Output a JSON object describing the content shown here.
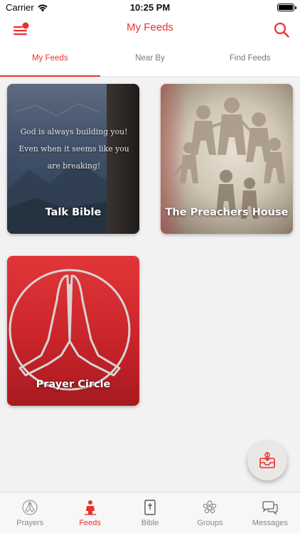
{
  "status_bar": {
    "carrier": "Carrier",
    "time": "10:25 PM"
  },
  "header": {
    "title": "My Feeds"
  },
  "top_tabs": [
    {
      "label": "My Feeds",
      "active": true
    },
    {
      "label": "Near By",
      "active": false
    },
    {
      "label": "Find Feeds",
      "active": false
    }
  ],
  "feeds": [
    {
      "name": "Talk Bible",
      "image_text": [
        "God is always building you!",
        "Even when it seems like you are breaking!"
      ]
    },
    {
      "name": "The Preachers House"
    },
    {
      "name": "Prayer Circle"
    }
  ],
  "bottom_tabs": [
    {
      "label": "Prayers",
      "icon": "praying-hands-icon",
      "active": false
    },
    {
      "label": "Feeds",
      "icon": "person-feed-icon",
      "active": true
    },
    {
      "label": "Bible",
      "icon": "bible-icon",
      "active": false
    },
    {
      "label": "Groups",
      "icon": "group-icon",
      "active": false
    },
    {
      "label": "Messages",
      "icon": "messages-icon",
      "active": false
    }
  ],
  "colors": {
    "accent": "#e8322e",
    "background": "#f2f2f2"
  }
}
